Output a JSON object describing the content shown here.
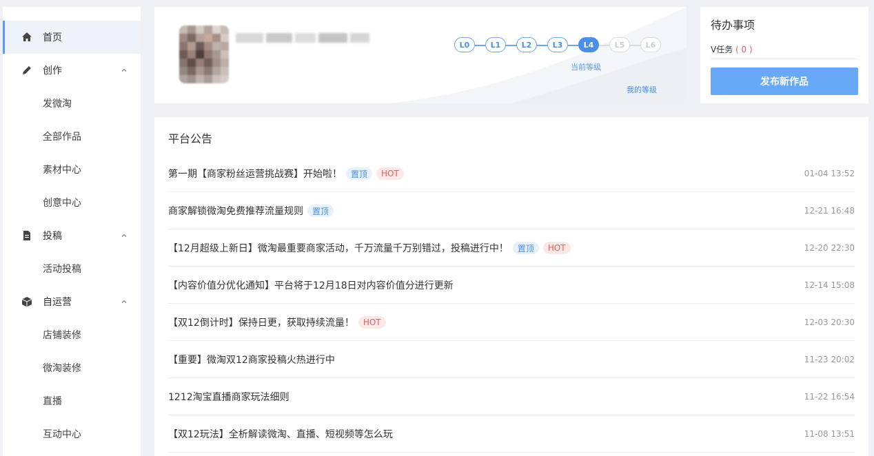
{
  "sidebar": {
    "home": "首页",
    "create": "创作",
    "create_items": [
      "发微淘",
      "全部作品",
      "素材中心",
      "创意中心"
    ],
    "submit": "投稿",
    "submit_items": [
      "活动投稿"
    ],
    "self_op": "自运营",
    "self_op_items": [
      "店铺装修",
      "微淘装修",
      "直播",
      "互动中心"
    ]
  },
  "profile": {
    "levels": [
      "L0",
      "L1",
      "L2",
      "L3",
      "L4",
      "L5",
      "L6"
    ],
    "current_level": "L4",
    "current_level_label": "当前等级",
    "my_level_link": "我的等级"
  },
  "todo": {
    "title": "待办事项",
    "task_label": "V任务",
    "task_count": "( 0 )",
    "publish_button": "发布新作品"
  },
  "announcements": {
    "title": "平台公告",
    "top_tag": "置顶",
    "hot_tag": "HOT",
    "items": [
      {
        "text": "第一期【商家粉丝运营挑战赛】开始啦！",
        "date": "01-04 13:52"
      },
      {
        "text": "商家解锁微淘免费推荐流量规则",
        "date": "12-21 16:48"
      },
      {
        "text": "【12月超级上新日】微淘最重要商家活动，千万流量千万别错过，投稿进行中！",
        "date": "12-20 22:30"
      },
      {
        "text": "【内容价值分优化通知】平台将于12月18日对内容价值分进行更新",
        "date": "12-14 15:08"
      },
      {
        "text": "【双12倒计时】保持日更，获取持续流量！",
        "date": "12-03 20:30"
      },
      {
        "text": "【重要】微淘双12商家投稿火热进行中",
        "date": "11-23 20:02"
      },
      {
        "text": "1212淘宝直播商家玩法细则",
        "date": "11-22 16:54"
      },
      {
        "text": "【双12玩法】全析解读微淘、直播、短视频等怎么玩",
        "date": "11-08 13:51"
      }
    ]
  },
  "colors": {
    "accent": "#4a8ee8",
    "button": "#67a9f7",
    "hot": "#f25a5a"
  }
}
